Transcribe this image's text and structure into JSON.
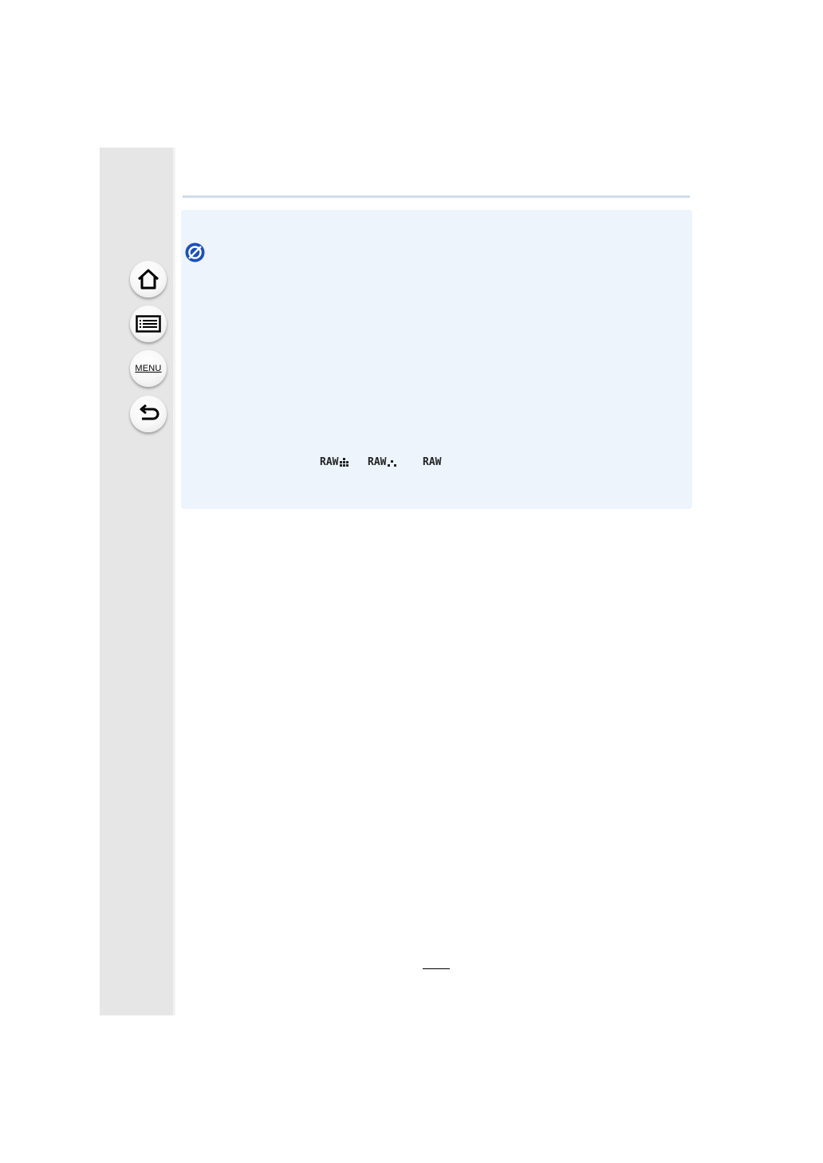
{
  "sidebar": {
    "buttons": [
      {
        "name": "home",
        "icon": "home-icon"
      },
      {
        "name": "contents",
        "icon": "list-icon"
      },
      {
        "name": "menu",
        "label": "MENU"
      },
      {
        "name": "back",
        "icon": "back-arrow-icon"
      }
    ]
  },
  "note": {
    "icon": "not-available-icon",
    "accent_color": "#1a4fbf",
    "raw_quality": [
      "RAW",
      "RAW",
      "RAW"
    ]
  }
}
